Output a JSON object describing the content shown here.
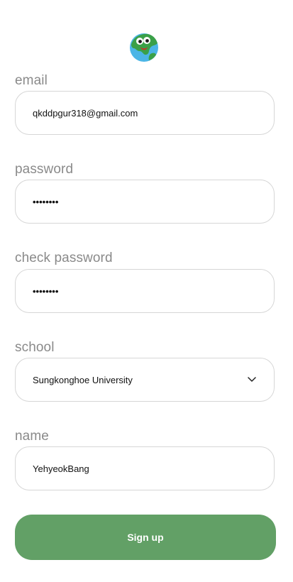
{
  "form": {
    "email_label": "email",
    "email_value": "qkddpgur318@gmail.com",
    "password_label": "password",
    "password_value": "••••••••",
    "check_password_label": "check password",
    "check_password_value": "••••••••",
    "school_label": "school",
    "school_value": "Sungkonghoe University",
    "name_label": "name",
    "name_value": "YehyeokBang",
    "signup_label": "Sign up"
  },
  "icons": {
    "logo": "earth-mascot-icon",
    "school_dropdown": "chevron-down-icon"
  },
  "colors": {
    "primary": "#62a066",
    "label": "#8a8a8a",
    "border": "#d6d6d6"
  }
}
